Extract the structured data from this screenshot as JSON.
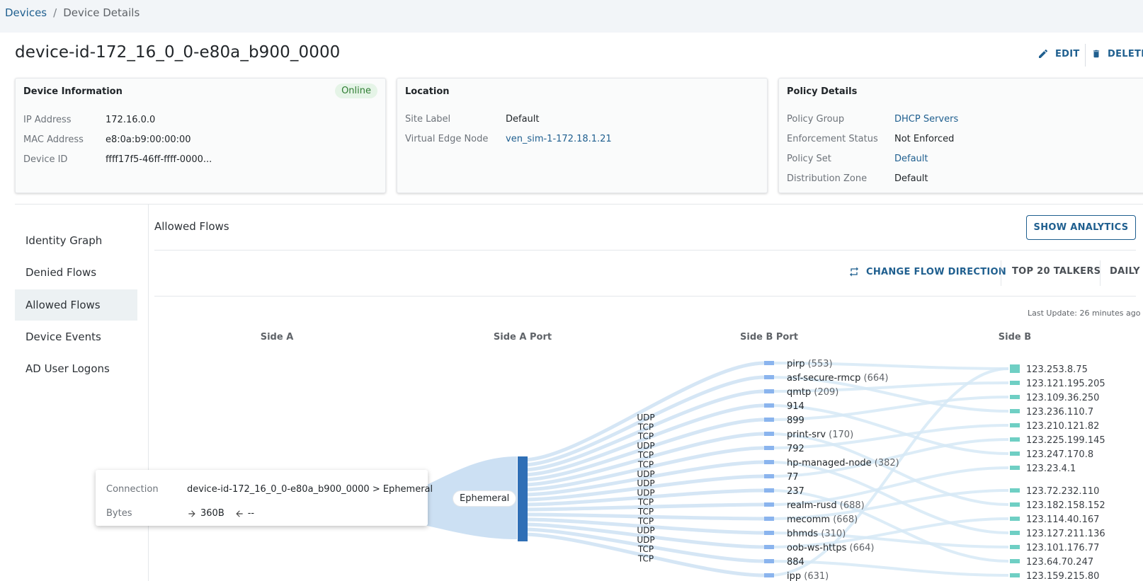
{
  "breadcrumb": {
    "root": "Devices",
    "separator": "/",
    "current": "Device Details"
  },
  "title": "device-id-172_16_0_0-e80a_b900_0000",
  "actions": {
    "edit": "EDIT",
    "delete": "DELETE"
  },
  "device_info": {
    "title": "Device Information",
    "status": "Online",
    "rows": [
      {
        "label": "IP Address",
        "value": "172.16.0.0"
      },
      {
        "label": "MAC Address",
        "value": "e8:0a:b9:00:00:00"
      },
      {
        "label": "Device ID",
        "value": "ffff17f5-46ff-ffff-0000..."
      }
    ]
  },
  "location": {
    "title": "Location",
    "rows": [
      {
        "label": "Site Label",
        "value": "Default"
      },
      {
        "label": "Virtual Edge Node",
        "value": "ven_sim-1-172.18.1.21"
      }
    ]
  },
  "policy": {
    "title": "Policy Details",
    "rows": [
      {
        "label": "Policy Group",
        "value": "DHCP Servers"
      },
      {
        "label": "Enforcement Status",
        "value": "Not Enforced"
      },
      {
        "label": "Policy Set",
        "value": "Default"
      },
      {
        "label": "Distribution Zone",
        "value": "Default"
      }
    ]
  },
  "nav": {
    "items": [
      "Identity Graph",
      "Denied Flows",
      "Allowed Flows",
      "Device Events",
      "AD User Logons"
    ],
    "active": "Allowed Flows"
  },
  "section": {
    "title": "Allowed Flows",
    "show_analytics": "SHOW ANALYTICS",
    "change_direction": "CHANGE FLOW DIRECTION",
    "top_talkers": "TOP 20 TALKERS",
    "period": "DAILY",
    "last_update": "Last Update: 26 minutes ago"
  },
  "columns": [
    "Side A",
    "Side A Port",
    "Side B Port",
    "Side B"
  ],
  "sankey": {
    "side_a_port": "Ephemeral",
    "protocols": [
      "UDP",
      "TCP",
      "TCP",
      "UDP",
      "TCP",
      "TCP",
      "UDP",
      "UDP",
      "UDP",
      "TCP",
      "TCP",
      "TCP",
      "UDP",
      "UDP",
      "TCP",
      "TCP"
    ],
    "side_b_ports": [
      {
        "name": "pirp",
        "count": "(553)"
      },
      {
        "name": "asf-secure-rmcp",
        "count": "(664)"
      },
      {
        "name": "qmtp",
        "count": "(209)"
      },
      {
        "name": "914",
        "count": ""
      },
      {
        "name": "899",
        "count": ""
      },
      {
        "name": "print-srv",
        "count": "(170)"
      },
      {
        "name": "792",
        "count": ""
      },
      {
        "name": "hp-managed-node",
        "count": "(382)"
      },
      {
        "name": "77",
        "count": ""
      },
      {
        "name": "237",
        "count": ""
      },
      {
        "name": "realm-rusd",
        "count": "(688)"
      },
      {
        "name": "mecomm",
        "count": "(668)"
      },
      {
        "name": "bhmds",
        "count": "(310)"
      },
      {
        "name": "oob-ws-https",
        "count": "(664)"
      },
      {
        "name": "884",
        "count": ""
      },
      {
        "name": "ipp",
        "count": "(631)"
      }
    ],
    "side_b": [
      "123.253.8.75",
      "123.121.195.205",
      "123.109.36.250",
      "123.236.110.7",
      "123.210.121.82",
      "123.225.199.145",
      "123.247.170.8",
      "123.23.4.1",
      "123.72.232.110",
      "123.182.158.152",
      "123.114.40.167",
      "123.127.211.136",
      "123.101.176.77",
      "123.64.70.247",
      "123.159.215.80"
    ]
  },
  "tooltip": {
    "connection_label": "Connection",
    "connection_value": "device-id-172_16_0_0-e80a_b900_0000 > Ephemeral",
    "bytes_label": "Bytes",
    "bytes_out": "360B",
    "bytes_in": "--"
  },
  "colors": {
    "accent": "#1f5f8f",
    "flow": "#c7ddf2",
    "port_node": "#2f6fb6",
    "b_port_node": "#8ab4ee",
    "b_node": "#6fcfc4"
  }
}
